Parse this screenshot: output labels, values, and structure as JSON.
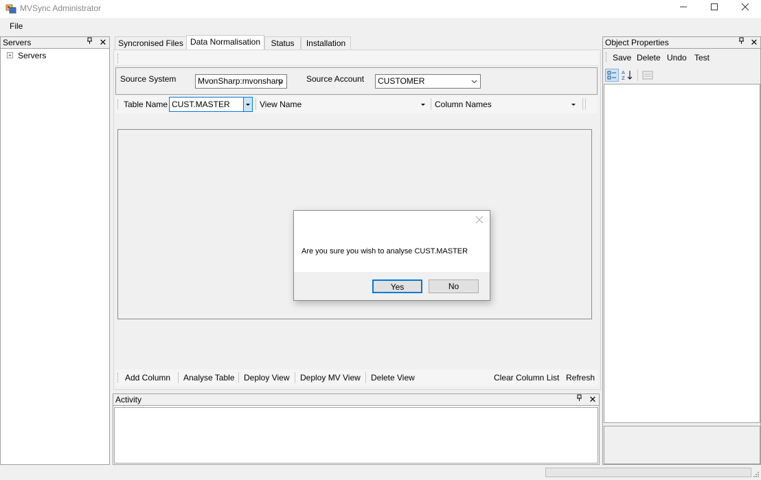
{
  "window": {
    "title": "MVSync Administrator"
  },
  "menu": {
    "file": "File"
  },
  "servers_panel": {
    "title": "Servers",
    "tree_root": "Servers"
  },
  "tabs": [
    {
      "label": "Syncronised Files"
    },
    {
      "label": "Data Normalisation"
    },
    {
      "label": "Status"
    },
    {
      "label": "Installation"
    }
  ],
  "source": {
    "system_label": "Source System",
    "system_value": "MvonSharp:mvonsharp",
    "account_label": "Source Account",
    "account_value": "CUSTOMER"
  },
  "table_toolbar": {
    "table_name_label": "Table Name",
    "table_name_value": "CUST.MASTER",
    "view_name_label": "View Name",
    "view_name_value": "",
    "column_names_label": "Column Names",
    "column_names_value": ""
  },
  "bottom_toolbar": {
    "add_column": "Add Column",
    "analyse_table": "Analyse Table",
    "deploy_view": "Deploy View",
    "deploy_mv_view": "Deploy MV View",
    "delete_view": "Delete View",
    "clear_column_list": "Clear Column List",
    "refresh": "Refresh"
  },
  "activity_panel": {
    "title": "Activity"
  },
  "properties_panel": {
    "title": "Object Properties",
    "save": "Save",
    "delete": "Delete",
    "undo": "Undo",
    "test": "Test"
  },
  "dialog": {
    "message": "Are you sure you wish to analyse CUST.MASTER",
    "yes": "Yes",
    "no": "No"
  }
}
